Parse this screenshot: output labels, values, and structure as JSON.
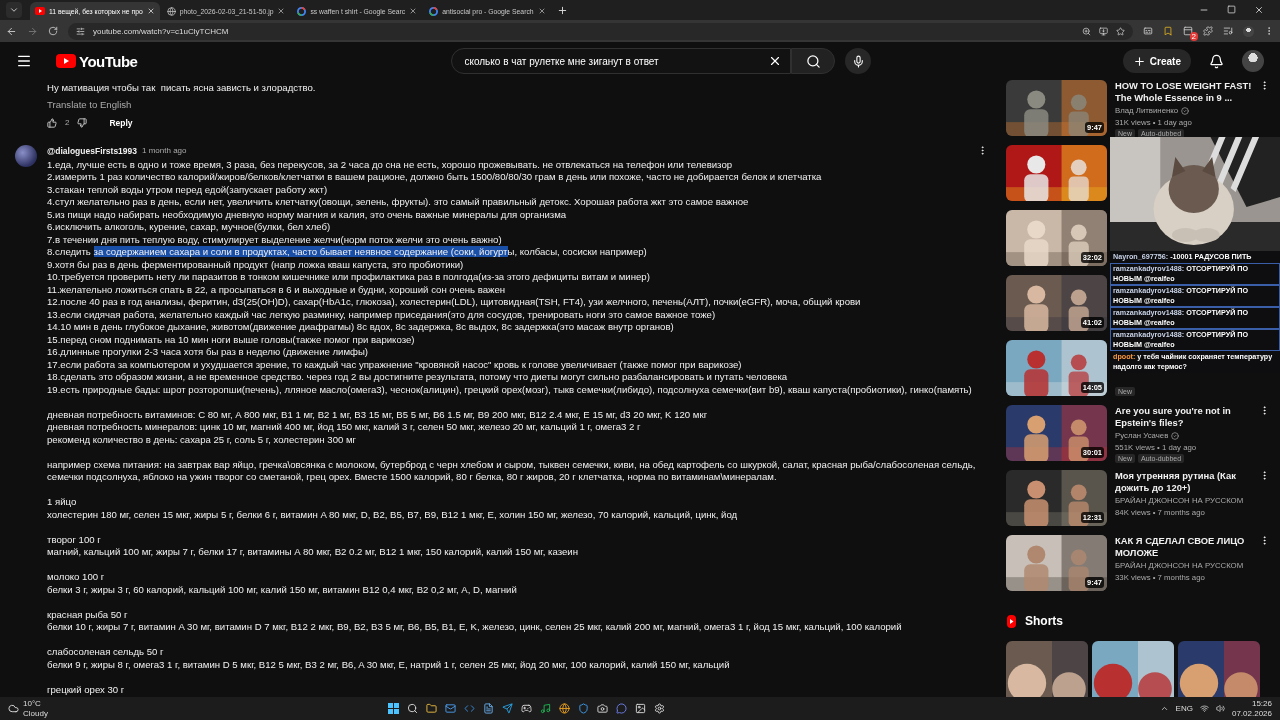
{
  "browser": {
    "tabs": [
      {
        "title": "11 вещей, без которых не про",
        "selected": true
      },
      {
        "title": "photo_2026-02-03_21-51-50.jp",
        "selected": false
      },
      {
        "title": "ss waffen t shirt - Google Searc",
        "selected": false
      },
      {
        "title": "antisocial pro - Google Search",
        "selected": false
      }
    ],
    "address": "youtube.com/watch?v=c1uClyTCHCM",
    "extension_badge": "2"
  },
  "header": {
    "logo": "YouTube",
    "search_value": "сколько в чат рулетке мне зиганут в ответ",
    "create": "Create"
  },
  "previous_comment": {
    "text": "Ну мативация чтобы так  писать ясна зависть и злорадство.",
    "translate": "Translate to English",
    "likes": "2",
    "reply": "Reply"
  },
  "comment": {
    "author": "@dialoguesFirsts1993",
    "time": "1 month ago",
    "paragraphs": [
      [
        "1.еда, лучше есть в одно и тоже время, 3 раза, без перекусов, за 2 часа до сна не есть, хорошо прожевывать. не отвлекаться на телефон или телевизор",
        "2.измерить 1 раз количество калорий/жиров/белков/клетчатки в вашем рационе, должно быть 1500/80/80/30 грам в день или похоже, часто не добирается белок и клетчатка",
        "3.стакан теплой воды утром перед едой(запускает работу жкт)",
        "4.стул желательно раз в день, если нет, увеличить клетчатку(овощи, зелень, фрукты). это самый правильный детокс. Хорошая работа жкт это самое важное",
        "5.из пищи надо набирать необходимую дневную норму магния и калия, это очень важные минералы для организма",
        "6.исключить алкоголь, курение, сахар, мучное(булки, бел хлеб)",
        "7.в течении дня пить теплую воду, стимулирует выделение желчи(норм поток желчи это очень важно)",
        {
          "kind": "selection",
          "before": "8.следить ",
          "selection": "за содержанием сахара и соли в продуктах, часто бывает неявное содержание (соки, йогурт",
          "after": "ы, колбасы, сосиски например)"
        },
        "9.хотя бы раз в день ферментированный продукт (напр ложка кваш капуста, это пробиотики)",
        "10.требуется проверить нету ли паразитов в тонком кишечнике или профилактика раз в полгода(из-за этого дефициты витам и минер)",
        "11.желательно ложиться спать в 22, а просыпаться в 6 и выходные и будни, хороший сон очень важен",
        "12.после 40 раз в год анализы, феритин, d3(25(OH)D), сахар(HbA1c, глюкоза), холестерин(LDL), щитовидная(TSH, FT4), узи желчного, печень(АЛТ), почки(eGFR), моча, общий крови",
        "13.если сидячая работа, желательно каждый час легкую разминку, например приседания(это для сосудов, тренировать ноги это самое важное тоже)",
        "14.10 мин в день глубокое дыхание, животом(движение диафрагмы) 8с вдох, 8с задержка, 8с выдох, 8с задержка(это масаж внутр органов)",
        "15.перед сном поднимать на 10 мин ноги выше головы(также помог при варикозе)",
        "16.длинные прогулки 2-3 часа хотя бы раз в неделю (движение лимфы)",
        "17.если работа за компьютером и ухудшается зрение, то каждый час упражнение \"кровяной насос\" кровь к голове увеличивает (также помог при варикозе)",
        "18.сделать это образом жизни, а не временное средство. через год 2 вы достигните результата, потому что диеты могут сильно разбалансировать и путать человека",
        "19.есть природные бады: шрот розторопши(печень), лляное масло(омега3), чеснок(алицин), грецкий орех(мозг), тыкв семечки(либидо), подсолнуха семечки(вит b9), кваш капуста(пробиотики), гинко(память)"
      ],
      [
        "дневная потребность витаминов: C 80 мг, A 800 мкг, B1 1 мг, B2 1 мг, B3 15 мг, B5 5 мг, B6 1.5 мг, B9 200 мкг, B12 2.4 мкг, E 15 мг, d3 20 мкг, K 120 мкг",
        "дневная потребность минералов: цинк 10 мг, магний 400 мг, йод 150 мкг, калий 3 г, селен 50 мкг, железо 20 мг, кальций 1 г, омега3 2 г",
        "рекоменд количество в день: сахара 25 г, соль 5 г, холестерин 300 мг"
      ],
      [
        "например схема питания: на завтрак вар яйцо, гречка\\овсянка с молоком, бутерброд с черн хлебом и сыром, тыквен семечки, киви, на обед картофель со шкуркой, салат, красная рыба/слабосоленая сельдь, семечки подсолнуха, яблоко на ужин творог со сметаной, грец орех. Вместе 1500 калорий, 80 г белка, 80 г жиров, 20 г клетчатка, норма по витаминам\\минералам."
      ],
      [
        "1 яйцо",
        "холестерин 180 мг, селен 15 мкг, жиры 5 г, белки 6 г, витамин A 80 мкг, D, B2, B5, B7, B9, B12 1 мкг, E, холин 150 мг, железо, 70 калорий, кальций, цинк, йод"
      ],
      [
        "творог 100 г",
        "магний, кальций 100 мг, жиры 7 г, белки 17 г, витамины A 80 мкг, B2 0.2 мг, B12 1 мкг, 150 калорий, калий 150 мг, казеин"
      ],
      [
        "молоко 100 г",
        "белки 3 г, жиры 3 г, 60 калорий, кальций 100 мг, калий 150 мг, витамин B12 0,4 мкг, B2 0,2 мг, A, D, магний"
      ],
      [
        "красная рыба 50 г",
        "белки 10 г, жиры 7 г, витамин A 30 мг, витамин D 7 мкг, B12 2 мкг, B9, B2, B3 5 мг, B6, B5, B1, E, K, железо, цинк, селен 25 мкг, калий 200 мг, магний, омега3 1 г, йод 15 мкг, кальций, 100 калорий"
      ],
      [
        "слабосоленая сельдь 50 г",
        "белки 9 г, жиры 8 г, омега3 1 г, витамин D 5 мкг, B12 5 мкг, B3 2 мг, B6, A 30 мкг, E, натрий 1 г, селен 25 мкг, йод 20 мкг, 100 калорий, калий 150 мг, кальций"
      ],
      [
        "грецкий орех 30 г"
      ]
    ]
  },
  "sidebar": {
    "videos": [
      {
        "kind": "video",
        "title": "HOW TO LOSE WEIGHT FAST! The Whole Essence in 9 ...",
        "channel": "Влад Литвиненко",
        "verified": true,
        "stats": "31K views • 1 day ago",
        "badges": [
          "New",
          "Auto-dubbed"
        ],
        "duration": "9:47"
      },
      {
        "kind": "covered"
      },
      {
        "kind": "covered",
        "duration": "32:02"
      },
      {
        "kind": "covered",
        "duration": "41:02"
      },
      {
        "kind": "covered",
        "duration": "14:05",
        "badges": [
          "New"
        ]
      },
      {
        "kind": "video",
        "title": "Are you sure you're not in Epstein's files?",
        "channel": "Руслан Усачев",
        "verified": true,
        "stats": "551K views • 1 day ago",
        "badges": [
          "New",
          "Auto-dubbed"
        ],
        "duration": "30:01"
      },
      {
        "kind": "video",
        "title": "Моя утренняя рутина (Как дожить до 120+)",
        "channel": "БРАЙАН ДЖОНСОН НА РУССКОМ",
        "verified": false,
        "stats": "84K views • 7 months ago",
        "duration": "12:31"
      },
      {
        "kind": "video",
        "title": "КАК Я СДЕЛАЛ СВОЕ ЛИЦО МОЛОЖЕ",
        "channel": "БРАЙАН ДЖОНСОН НА РУССКОМ",
        "verified": false,
        "stats": "33K views • 7 months ago",
        "duration": "9:47"
      }
    ],
    "shorts_title": "Shorts"
  },
  "chat_overlay": {
    "messages": [
      {
        "user": "Nayron_697756:",
        "text": "-10001 РАДУСОВ ПИТЬ",
        "color": "#c8d2e6",
        "highlighted": false
      },
      {
        "user": "ramzankadyrov1488:",
        "text": "ОТСОРТИРУЙ ПО НОВЫМ @realfeo",
        "color": "#c8d2e6",
        "highlighted": true
      },
      {
        "user": "ramzankadyrov1488:",
        "text": "ОТСОРТИРУЙ ПО НОВЫМ @realfeo",
        "color": "#c8d2e6",
        "highlighted": true
      },
      {
        "user": "ramzankadyrov1488:",
        "text": "ОТСОРТИРУЙ ПО НОВЫМ @realfeo",
        "color": "#c8d2e6",
        "highlighted": true
      },
      {
        "user": "ramzankadyrov1488:",
        "text": "ОТСОРТИРУЙ ПО НОВЫМ @realfeo",
        "color": "#c8d2e6",
        "highlighted": true
      },
      {
        "user": "dpoot:",
        "text": "у тебя чайник сохраняет температуру надолго как термос?",
        "color": "#ff9a3c",
        "highlighted": false
      }
    ]
  },
  "taskbar": {
    "temperature": "10°C",
    "weather": "Cloudy",
    "language": "ENG",
    "time": "15:26",
    "date": "07.02.2026"
  }
}
